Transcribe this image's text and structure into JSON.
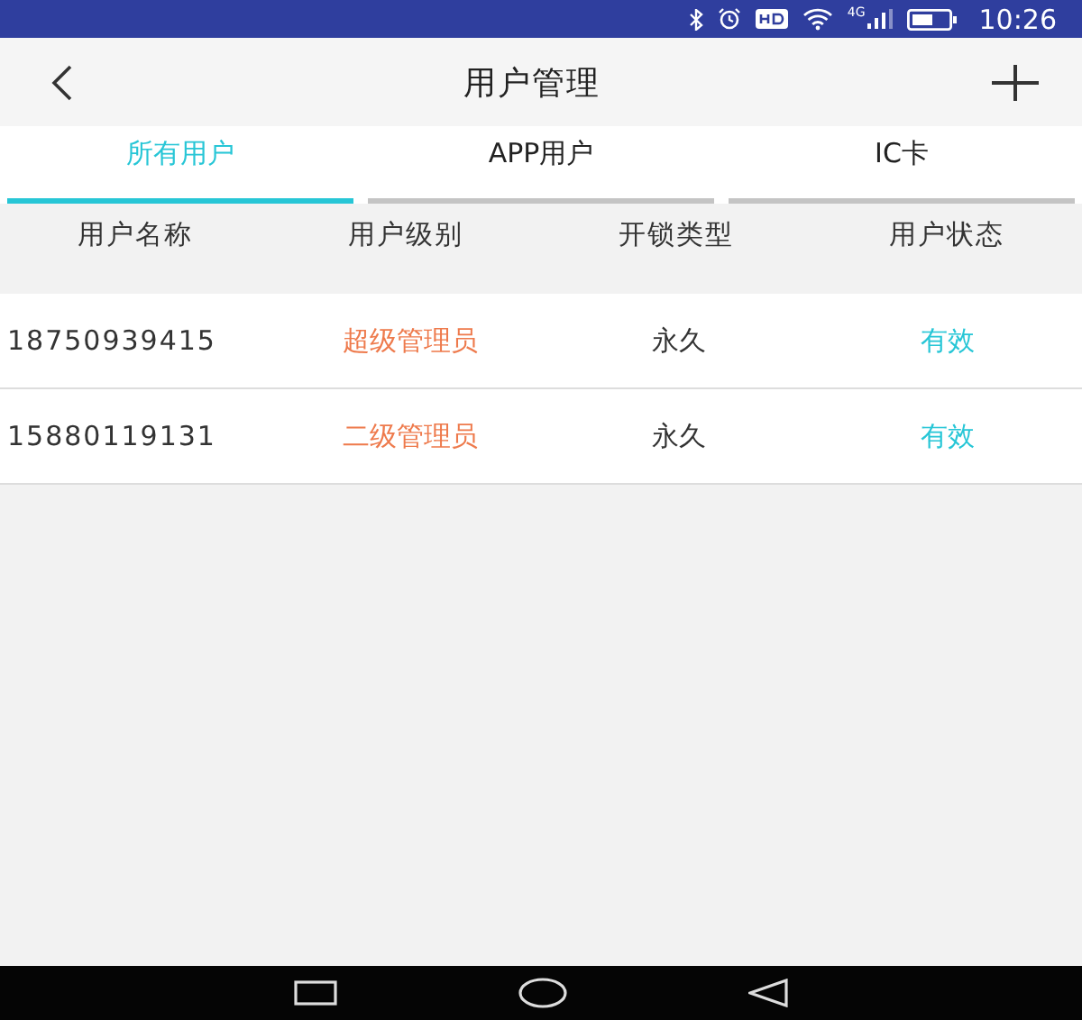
{
  "status_bar": {
    "network": "4G",
    "time": "10:26"
  },
  "header": {
    "title": "用户管理"
  },
  "tabs": [
    {
      "label": "所有用户",
      "selected": true
    },
    {
      "label": "APP用户",
      "selected": false
    },
    {
      "label": "IC卡",
      "selected": false
    }
  ],
  "table": {
    "columns": [
      "用户名称",
      "用户级别",
      "开锁类型",
      "用户状态"
    ],
    "rows": [
      {
        "name": "18750939415",
        "level": "超级管理员",
        "unlock_type": "永久",
        "status": "有效"
      },
      {
        "name": "15880119131",
        "level": "二级管理员",
        "unlock_type": "永久",
        "status": "有效"
      }
    ]
  }
}
